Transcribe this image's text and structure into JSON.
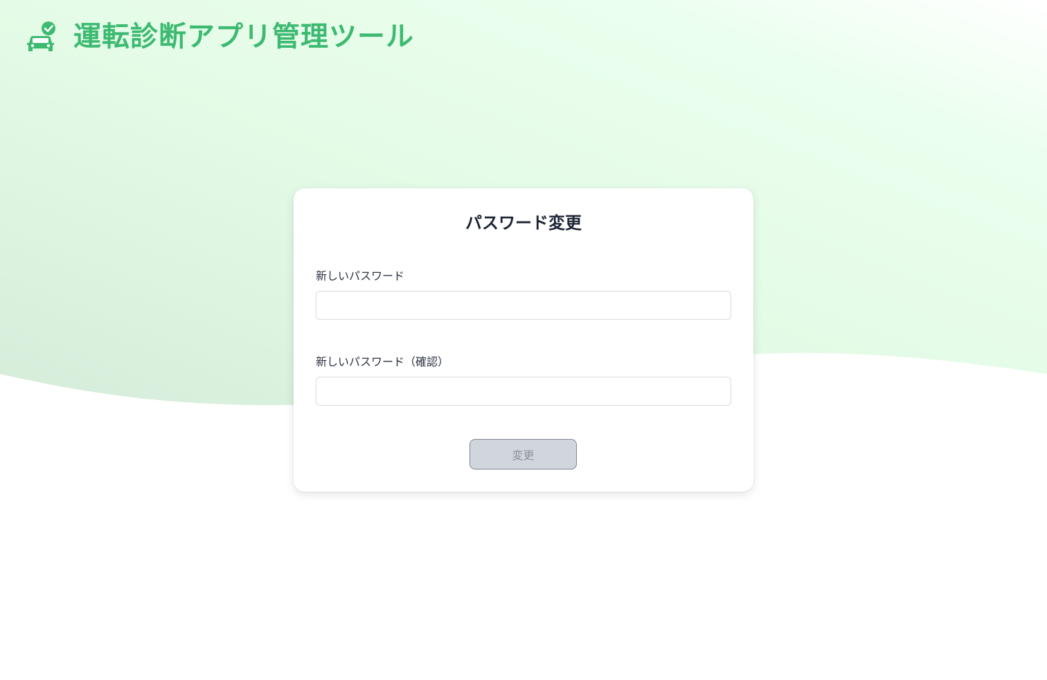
{
  "header": {
    "logo_icon": "car-check-icon",
    "app_title": "運転診断アプリ管理ツール"
  },
  "colors": {
    "brand_green": "#3dba71",
    "bg_gradient_start": "#d6eedb",
    "bg_gradient_end": "#e6ffe9",
    "button_disabled_bg": "#d1d5dc"
  },
  "form": {
    "title": "パスワード変更",
    "new_password": {
      "label": "新しいパスワード",
      "value": ""
    },
    "confirm_password": {
      "label": "新しいパスワード（確認）",
      "value": ""
    },
    "submit_label": "変更",
    "submit_disabled": true
  }
}
